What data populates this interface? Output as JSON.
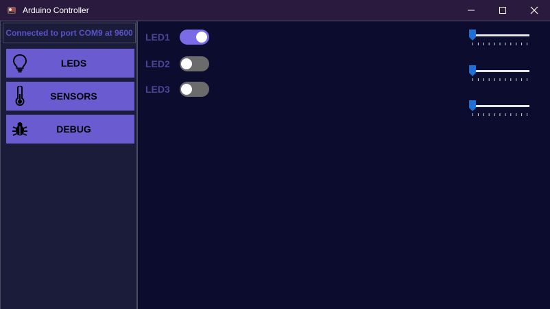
{
  "window": {
    "title": "Arduino Controller",
    "minimize_glyph": "—",
    "maximize_glyph": "☐",
    "close_glyph": "✕"
  },
  "sidebar": {
    "status": "Connected to port COM9 at 9600",
    "items": [
      {
        "label": "LEDS",
        "icon": "lightbulb-icon"
      },
      {
        "label": "SENSORS",
        "icon": "thermometer-icon"
      },
      {
        "label": "DEBUG",
        "icon": "bug-icon"
      }
    ]
  },
  "main": {
    "leds": [
      {
        "label": "LED1",
        "on": true
      },
      {
        "label": "LED2",
        "on": false
      },
      {
        "label": "LED3",
        "on": false
      }
    ],
    "sliders": [
      {
        "value": 0
      },
      {
        "value": 0
      },
      {
        "value": 0
      }
    ]
  },
  "colors": {
    "accent": "#6a5bd1",
    "toggle_on": "#7b6be6",
    "toggle_off": "#6b6b6b",
    "slider_thumb": "#1f6fd6",
    "background": "#0c0d2e"
  }
}
